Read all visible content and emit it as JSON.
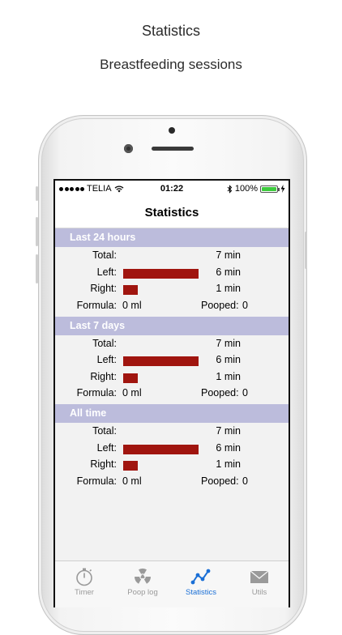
{
  "promo": {
    "title": "Statistics",
    "subtitle": "Breastfeeding sessions"
  },
  "status_bar": {
    "carrier": "TELIA",
    "time": "01:22",
    "battery": "100%",
    "battery_level": 1.0
  },
  "nav": {
    "title": "Statistics"
  },
  "sections": [
    {
      "title": "Last 24 hours",
      "total_label": "Total:",
      "total": "7 min",
      "left_label": "Left:",
      "left": "6 min",
      "left_fraction": 0.857,
      "right_label": "Right:",
      "right": "1 min",
      "right_fraction": 0.171,
      "formula_label": "Formula:",
      "formula": "0 ml",
      "pooped_label": "Pooped:",
      "pooped": "0"
    },
    {
      "title": "Last 7 days",
      "total_label": "Total:",
      "total": "7 min",
      "left_label": "Left:",
      "left": "6 min",
      "left_fraction": 0.857,
      "right_label": "Right:",
      "right": "1 min",
      "right_fraction": 0.171,
      "formula_label": "Formula:",
      "formula": "0 ml",
      "pooped_label": "Pooped:",
      "pooped": "0"
    },
    {
      "title": "All time",
      "total_label": "Total:",
      "total": "7 min",
      "left_label": "Left:",
      "left": "6 min",
      "left_fraction": 0.857,
      "right_label": "Right:",
      "right": "1 min",
      "right_fraction": 0.171,
      "formula_label": "Formula:",
      "formula": "0 ml",
      "pooped_label": "Pooped:",
      "pooped": "0"
    }
  ],
  "tabs": [
    {
      "label": "Timer",
      "icon": "stopwatch-icon",
      "active": false
    },
    {
      "label": "Poop log",
      "icon": "radiation-icon",
      "active": false
    },
    {
      "label": "Statistics",
      "icon": "graph-icon",
      "active": true
    },
    {
      "label": "Utils",
      "icon": "envelope-icon",
      "active": false
    }
  ],
  "colors": {
    "section_header": "#bcbcdc",
    "bar": "#a0150f",
    "active_tab": "#1a6fd6",
    "battery": "#3ecb3e"
  }
}
